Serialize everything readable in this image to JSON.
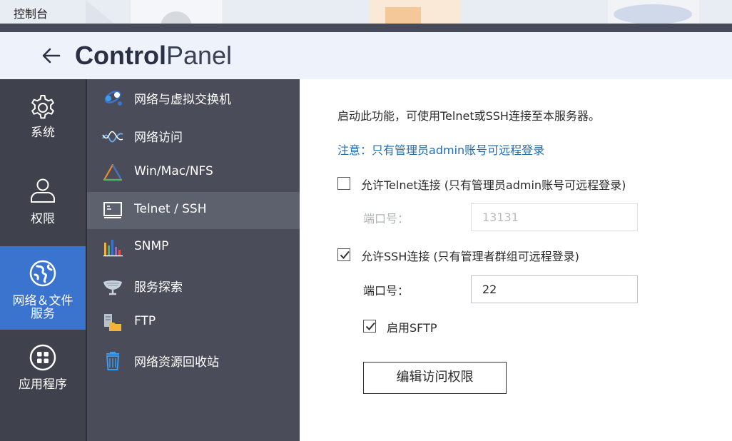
{
  "window": {
    "title": "控制台"
  },
  "header": {
    "brand_bold": "Control",
    "brand_light": "Panel"
  },
  "nav_primary": [
    {
      "label": "系统",
      "icon": "gear-icon"
    },
    {
      "label": "权限",
      "icon": "user-icon"
    },
    {
      "label_line1": "网络＆文件",
      "label_line2": "服务",
      "icon": "globe-icon",
      "active": true
    },
    {
      "label": "应用程序",
      "icon": "apps-grid-icon"
    }
  ],
  "nav_secondary": [
    {
      "label": "网络与虚拟交换机",
      "icon": "network-switch-icon"
    },
    {
      "label": "网络访问",
      "icon": "network-access-icon"
    },
    {
      "label": "Win/Mac/NFS",
      "icon": "triangle-share-icon"
    },
    {
      "label": "Telnet / SSH",
      "icon": "terminal-icon",
      "active": true
    },
    {
      "label": "SNMP",
      "icon": "bar-chart-icon"
    },
    {
      "label": "服务探索",
      "icon": "satellite-dish-icon"
    },
    {
      "label": "FTP",
      "icon": "ftp-folder-icon"
    },
    {
      "label": "网络资源回收站",
      "icon": "recycle-bin-icon"
    }
  ],
  "content": {
    "description": "启动此功能，可使用Telnet或SSH连接至本服务器。",
    "note_label": "注意：",
    "note_text": "只有管理员admin账号可远程登录",
    "telnet": {
      "label": "允许Telnet连接 (只有管理员admin账号可远程登录)",
      "checked": false,
      "port_label": "端口号：",
      "port_value": "13131"
    },
    "ssh": {
      "label": "允许SSH连接 (只有管理者群组可远程登录)",
      "checked": true,
      "port_label": "端口号：",
      "port_value": "22"
    },
    "sftp": {
      "label": "启用SFTP",
      "checked": true
    },
    "edit_button": "编辑访问权限"
  },
  "colors": {
    "accent": "#3a74cf",
    "note": "#1f6cae",
    "nav_primary_bg": "#3f424d",
    "nav_secondary_bg": "#4a4d59",
    "nav_secondary_active": "#5d616d"
  }
}
